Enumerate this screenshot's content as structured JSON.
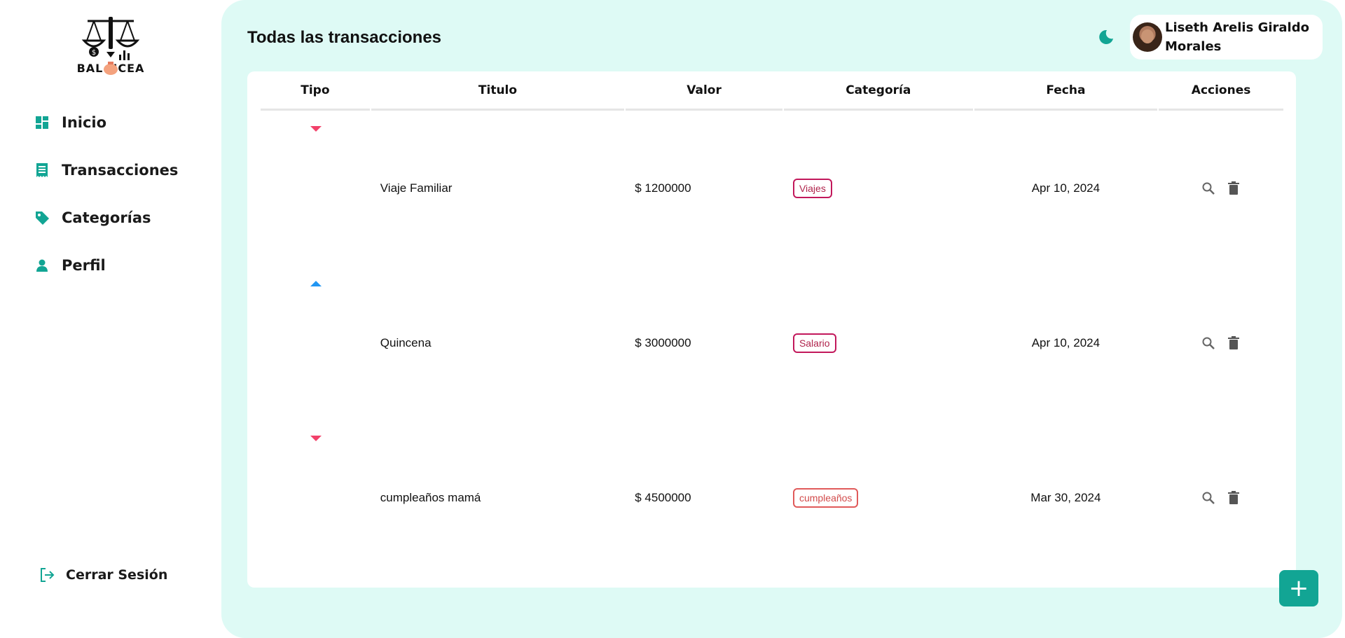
{
  "brand": {
    "logo_text": "BAL NCEA",
    "accent": "#12a594",
    "main_bg": "#defaf5"
  },
  "sidebar": {
    "items": [
      {
        "label": "Inicio",
        "icon": "dashboard-icon"
      },
      {
        "label": "Transacciones",
        "icon": "receipt-icon"
      },
      {
        "label": "Categorías",
        "icon": "tag-icon"
      },
      {
        "label": "Perfil",
        "icon": "person-icon"
      }
    ],
    "logout_label": "Cerrar Sesión"
  },
  "header": {
    "title": "Todas las transacciones",
    "user_name": "Liseth Arelis Giraldo Morales"
  },
  "table": {
    "columns": [
      "Tipo",
      "Titulo",
      "Valor",
      "Categoría",
      "Fecha",
      "Acciones"
    ],
    "rows": [
      {
        "type": "expense",
        "title": "Viaje Familiar",
        "value": "$ 1200000",
        "category": "Viajes",
        "date": "Apr 10, 2024"
      },
      {
        "type": "income",
        "title": "Quincena",
        "value": "$ 3000000",
        "category": "Salario",
        "date": "Apr 10, 2024"
      },
      {
        "type": "expense",
        "title": "cumpleaños mamá",
        "value": "$ 4500000",
        "category": "cumpleaños",
        "date": "Mar 30, 2024"
      }
    ]
  },
  "fab": {
    "label": "+"
  }
}
